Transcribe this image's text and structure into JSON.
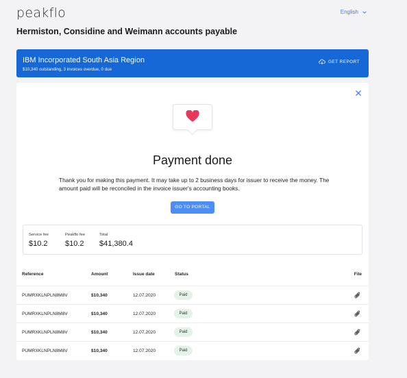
{
  "header": {
    "logo": "peakflo",
    "language": "English"
  },
  "page": {
    "title": "Hermiston, Considine and Weimann accounts payable"
  },
  "banner": {
    "company": "IBM Incorporated South Asia Region",
    "summary": "$10,340 outstanding, 3 invoices overdue, 0 due",
    "report_label": "GET REPORT"
  },
  "payment": {
    "title": "Payment done",
    "message": "Thank you for making this payment. It may take up to 2 business days for issuer to receive the money. The amount paid will be reconciled in the invoice issuer's accounting books.",
    "portal_label": "GO TO PORTAL"
  },
  "fees": {
    "service_label": "Service fee",
    "service_value": "$10.2",
    "peakflo_label": "Peakflo fee",
    "peakflo_value": "$10.2",
    "total_label": "Total",
    "total_value": "$41,380.4"
  },
  "table": {
    "headers": {
      "reference": "Reference",
      "amount": "Amount",
      "issue_date": "Issue date",
      "status": "Status",
      "file": "File"
    },
    "rows": [
      {
        "reference": "PUMRXKLNPLN8M8V",
        "amount": "$10,340",
        "issue_date": "12.07.2020",
        "status": "Paid"
      },
      {
        "reference": "PUMRXKLNPLN8M8V",
        "amount": "$10,340",
        "issue_date": "12.07.2020",
        "status": "Paid"
      },
      {
        "reference": "PUMRXKLNPLN8M8V",
        "amount": "$10,340",
        "issue_date": "12.07.2020",
        "status": "Paid"
      },
      {
        "reference": "PUMRXKLNPLN8M8V",
        "amount": "$10,340",
        "issue_date": "12.07.2020",
        "status": "Paid"
      }
    ]
  },
  "icons": {
    "chevron": "chevron-down-icon",
    "cloud": "cloud-download-icon",
    "close": "close-icon",
    "heart": "heart-icon",
    "file": "paperclip-icon"
  },
  "colors": {
    "brand": "#1668d6",
    "button": "#4c8df6",
    "heart": "#e8365d",
    "paid_badge": "#e3f3e7"
  }
}
